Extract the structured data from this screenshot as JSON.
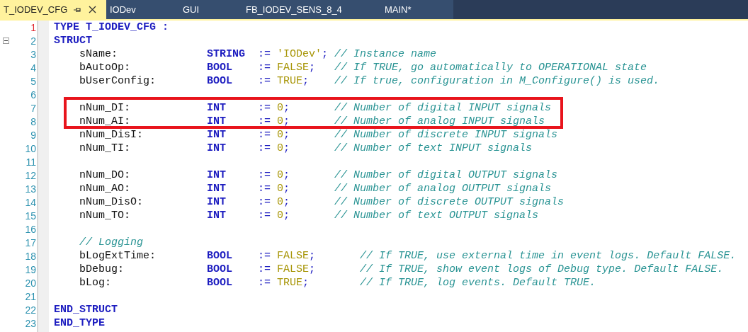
{
  "tabs": [
    {
      "label": "T_IODEV_CFG",
      "selected": true
    },
    {
      "label": "IODev",
      "selected": false
    },
    {
      "label": "GUI",
      "selected": false
    },
    {
      "label": "FB_IODEV_SENS_8_4",
      "selected": false
    },
    {
      "label": "MAIN*",
      "selected": false
    }
  ],
  "gutter": {
    "line_numbers": [
      {
        "text": "1",
        "current": true,
        "foldable": false
      },
      {
        "text": "2",
        "current": false,
        "foldable": true
      },
      {
        "text": "3",
        "current": false,
        "foldable": false
      },
      {
        "text": "4",
        "current": false,
        "foldable": false
      },
      {
        "text": "5",
        "current": false,
        "foldable": false
      },
      {
        "text": "6",
        "current": false,
        "foldable": false
      },
      {
        "text": "7",
        "current": false,
        "foldable": false
      },
      {
        "text": "8",
        "current": false,
        "foldable": false
      },
      {
        "text": "9",
        "current": false,
        "foldable": false
      },
      {
        "text": "10",
        "current": false,
        "foldable": false
      },
      {
        "text": "11",
        "current": false,
        "foldable": false
      },
      {
        "text": "12",
        "current": false,
        "foldable": false
      },
      {
        "text": "13",
        "current": false,
        "foldable": false
      },
      {
        "text": "14",
        "current": false,
        "foldable": false
      },
      {
        "text": "15",
        "current": false,
        "foldable": false
      },
      {
        "text": "16",
        "current": false,
        "foldable": false
      },
      {
        "text": "17",
        "current": false,
        "foldable": false
      },
      {
        "text": "18",
        "current": false,
        "foldable": false
      },
      {
        "text": "19",
        "current": false,
        "foldable": false
      },
      {
        "text": "20",
        "current": false,
        "foldable": false
      },
      {
        "text": "21",
        "current": false,
        "foldable": false
      },
      {
        "text": "22",
        "current": false,
        "foldable": false
      },
      {
        "text": "23",
        "current": false,
        "foldable": false
      }
    ]
  },
  "code": {
    "header": "TYPE T_IODEV_CFG :",
    "open": "STRUCT",
    "groups": [
      {
        "kind": "narrow",
        "fields": [
          {
            "name": "sName:",
            "type": "STRING",
            "operator": ":=",
            "value": "'IODev'",
            "semicolon": ";",
            "comment": "// Instance name",
            "highlighted": false
          },
          {
            "name": "bAutoOp:",
            "type": "BOOL",
            "operator": ":=",
            "value": "FALSE",
            "semicolon": ";",
            "comment": "// If TRUE, go automatically to OPERATIONAL state",
            "highlighted": false
          },
          {
            "name": "bUserConfig:",
            "type": "BOOL",
            "operator": ":=",
            "value": "TRUE",
            "semicolon": ";",
            "comment": "// If true, configuration in M_Configure() is used.",
            "highlighted": false
          }
        ]
      },
      {
        "kind": "narrow",
        "fields": [
          {
            "name": "nNum_DI:",
            "type": "INT",
            "operator": ":=",
            "value": "0",
            "semicolon": ";",
            "comment": "// Number of digital INPUT signals",
            "highlighted": true
          },
          {
            "name": "nNum_AI:",
            "type": "INT",
            "operator": ":=",
            "value": "0",
            "semicolon": ";",
            "comment": "// Number of analog INPUT signals",
            "highlighted": true
          },
          {
            "name": "nNum_DisI:",
            "type": "INT",
            "operator": ":=",
            "value": "0",
            "semicolon": ";",
            "comment": "// Number of discrete INPUT signals",
            "highlighted": false
          },
          {
            "name": "nNum_TI:",
            "type": "INT",
            "operator": ":=",
            "value": "0",
            "semicolon": ";",
            "comment": "// Number of text INPUT signals",
            "highlighted": false
          }
        ]
      },
      {
        "kind": "narrow",
        "fields": [
          {
            "name": "nNum_DO:",
            "type": "INT",
            "operator": ":=",
            "value": "0",
            "semicolon": ";",
            "comment": "// Number of digital OUTPUT signals",
            "highlighted": false
          },
          {
            "name": "nNum_AO:",
            "type": "INT",
            "operator": ":=",
            "value": "0",
            "semicolon": ";",
            "comment": "// Number of analog OUTPUT signals",
            "highlighted": false
          },
          {
            "name": "nNum_DisO:",
            "type": "INT",
            "operator": ":=",
            "value": "0",
            "semicolon": ";",
            "comment": "// Number of discrete OUTPUT signals",
            "highlighted": false
          },
          {
            "name": "nNum_TO:",
            "type": "INT",
            "operator": ":=",
            "value": "0",
            "semicolon": ";",
            "comment": "// Number of text OUTPUT signals",
            "highlighted": false
          }
        ]
      },
      {
        "kind": "wide",
        "heading": "// Logging",
        "fields": [
          {
            "name": "bLogExtTime:",
            "type": "BOOL",
            "operator": ":=",
            "value": "FALSE",
            "semicolon": ";",
            "comment": "// If TRUE, use external time in event logs. Default FALSE.",
            "highlighted": false
          },
          {
            "name": "bDebug:",
            "type": "BOOL",
            "operator": ":=",
            "value": "FALSE",
            "semicolon": ";",
            "comment": "// If TRUE, show event logs of Debug type. Default FALSE.",
            "highlighted": false
          },
          {
            "name": "bLog:",
            "type": "BOOL",
            "operator": ":=",
            "value": "TRUE",
            "semicolon": ";",
            "comment": "// If TRUE, log events. Default TRUE.",
            "highlighted": false
          }
        ]
      }
    ],
    "close": [
      "END_STRUCT",
      "END_TYPE"
    ]
  }
}
